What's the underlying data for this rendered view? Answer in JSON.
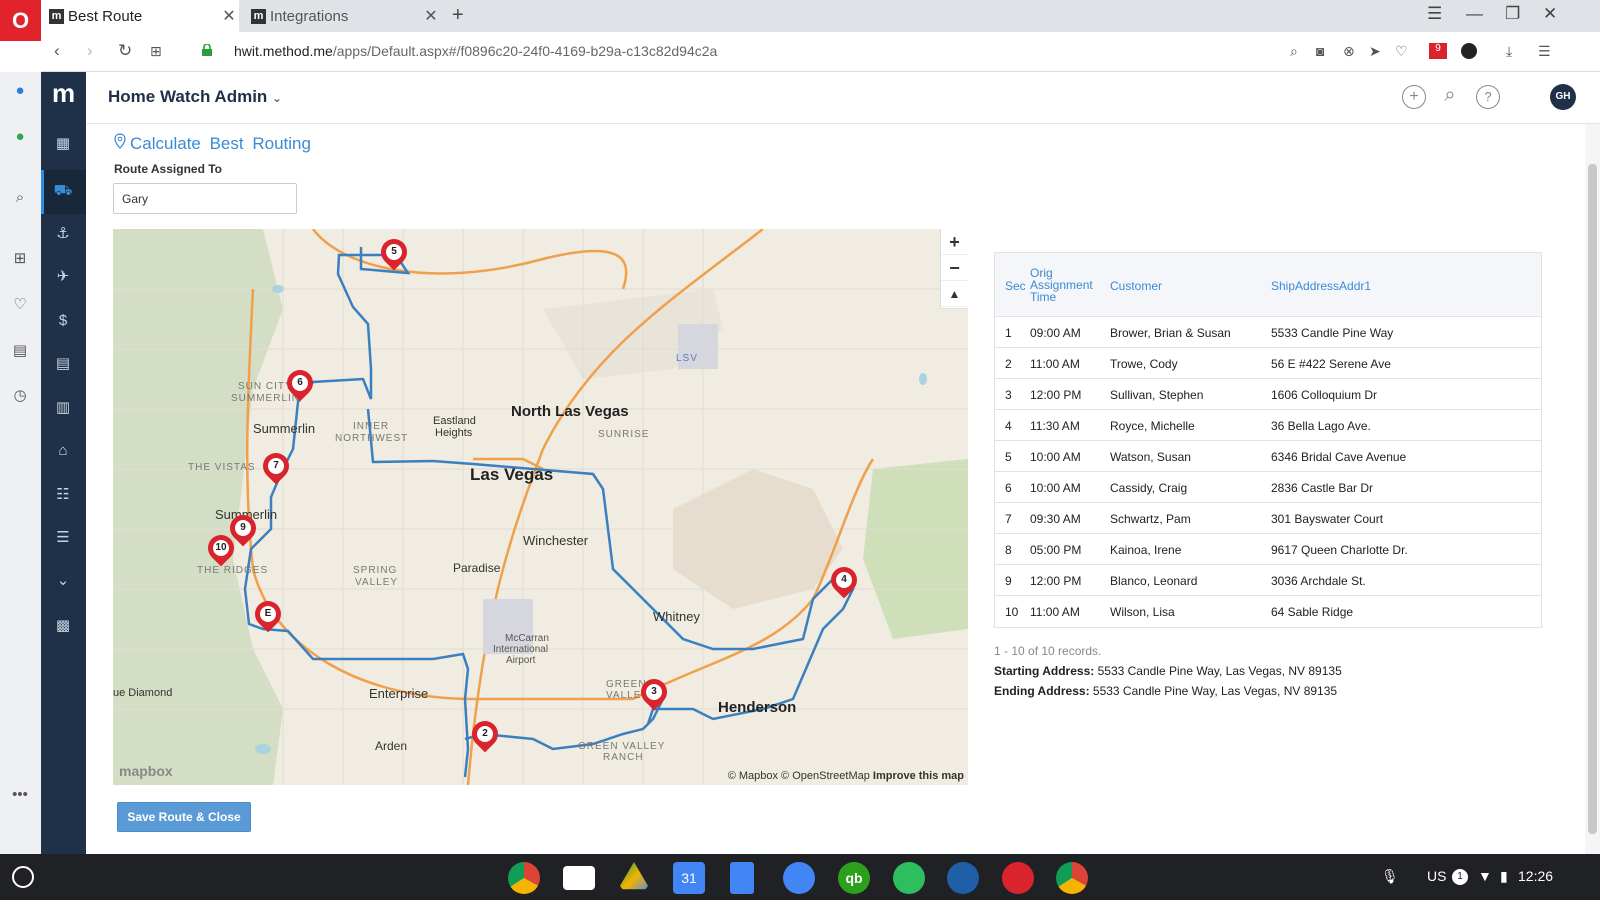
{
  "browser": {
    "tabs": [
      {
        "label": "Best Route",
        "favicon": "m"
      },
      {
        "label": "Integrations",
        "favicon": "m"
      }
    ],
    "url_host": "hwit.method.me",
    "url_path": "/apps/Default.aspx#/f0896c20-24f0-4169-b29a-c13c82d94c2a",
    "url_prefix": ""
  },
  "app": {
    "title": "Home Watch Admin",
    "avatar": "GH"
  },
  "page": {
    "title": "Calculate Best Routing",
    "assigned_label": "Route Assigned To",
    "assigned_value": "Gary",
    "save_button": "Save Route & Close"
  },
  "map": {
    "zoom_in": "+",
    "zoom_out": "−",
    "labels": {
      "north_las_vegas": "North Las Vegas",
      "las_vegas": "Las Vegas",
      "summerlin1": "Summerlin",
      "summerlin2": "Summerlin",
      "eastland": "Eastland",
      "heights": "Heights",
      "winchester": "Winchester",
      "paradise": "Paradise",
      "whitney": "Whitney",
      "henderson": "Henderson",
      "enterprise": "Enterprise",
      "arden": "Arden",
      "blue_diamond": "ue Diamond",
      "mccarran1": "McCarran",
      "mccarran2": "International",
      "mccarran3": "Airport",
      "sunrise": "SUNRISE",
      "the_vistas": "THE VISTAS",
      "the_ridges": "THE RIDGES",
      "spring_valley1": "SPRING",
      "spring_valley2": "VALLEY",
      "inner_nw1": "INNER",
      "inner_nw2": "NORTHWEST",
      "green_valley1": "GREEN",
      "green_valley2": "VALLEY",
      "gv_ranch1": "GREEN VALLEY",
      "gv_ranch2": "RANCH",
      "sun_city1": "SUN CITY",
      "sun_city2": "SUMMERLIN",
      "lsv": "LSV"
    },
    "pins": [
      "5",
      "6",
      "7",
      "9",
      "10",
      "E",
      "2",
      "3",
      "4"
    ],
    "attribution_osm": "© Mapbox © OpenStreetMap",
    "attribution_improve": "Improve this map",
    "logo": "mapbox"
  },
  "table": {
    "headers": {
      "seq": "Sec",
      "orig1": "Orig",
      "orig2": "Assignment",
      "orig3": "Time",
      "customer": "Customer",
      "address": "ShipAddressAddr1"
    },
    "rows": [
      {
        "seq": "1",
        "time": "09:00 AM",
        "customer": "Brower, Brian & Susan",
        "address": "5533 Candle Pine Way"
      },
      {
        "seq": "2",
        "time": "11:00 AM",
        "customer": "Trowe, Cody",
        "address": "56 E #422 Serene Ave"
      },
      {
        "seq": "3",
        "time": "12:00 PM",
        "customer": "Sullivan, Stephen",
        "address": "1606 Colloquium Dr"
      },
      {
        "seq": "4",
        "time": "11:30 AM",
        "customer": "Royce, Michelle",
        "address": "36 Bella Lago Ave."
      },
      {
        "seq": "5",
        "time": "10:00 AM",
        "customer": "Watson, Susan",
        "address": "6346 Bridal Cave Avenue"
      },
      {
        "seq": "6",
        "time": "10:00 AM",
        "customer": "Cassidy, Craig",
        "address": "2836 Castle Bar Dr"
      },
      {
        "seq": "7",
        "time": "09:30 AM",
        "customer": "Schwartz, Pam",
        "address": "301 Bayswater Court"
      },
      {
        "seq": "8",
        "time": "05:00 PM",
        "customer": "Kainoa, Irene",
        "address": "9617 Queen Charlotte Dr."
      },
      {
        "seq": "9",
        "time": "12:00 PM",
        "customer": "Blanco, Leonard",
        "address": "3036 Archdale St."
      },
      {
        "seq": "10",
        "time": "11:00 AM",
        "customer": "Wilson, Lisa",
        "address": "64 Sable Ridge"
      }
    ],
    "records": "1 - 10 of 10 records.",
    "starting_label": "Starting Address:",
    "starting_value": "5533 Candle Pine Way, Las Vegas, NV 89135",
    "ending_label": "Ending Address:",
    "ending_value": "5533 Candle Pine Way, Las Vegas, NV 89135"
  },
  "shelf": {
    "locale": "US",
    "notifications": "1",
    "time": "12:26"
  },
  "colors": {
    "accent": "#3a8bd4",
    "nav_bg": "#1f3148",
    "pin": "#d9232d",
    "route": "#3a7fc0"
  }
}
